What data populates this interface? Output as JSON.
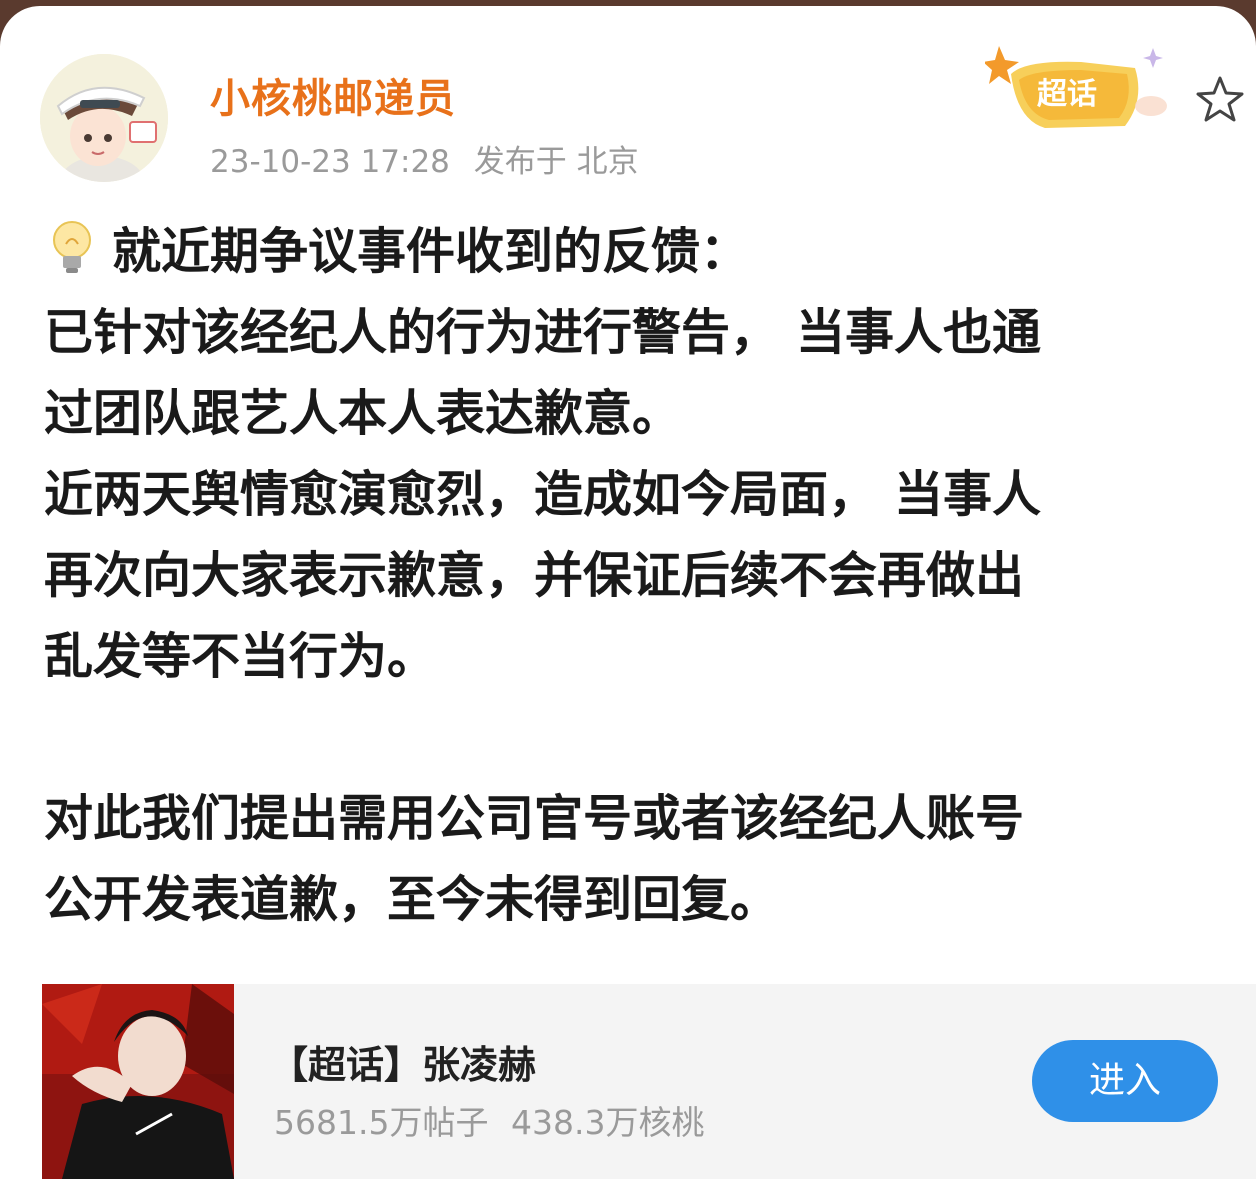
{
  "post": {
    "author": "小核桃邮递员",
    "timestamp": "23-10-23 17:28",
    "location": "发布于 北京",
    "badge_label": "超话",
    "content_lines": [
      "就近期争议事件收到的反馈：",
      "已针对该经纪人的行为进行警告， 当事人也通",
      "过团队跟艺人本人表达歉意。",
      "近两天舆情愈演愈烈，造成如今局面， 当事人",
      "再次向大家表示歉意，并保证后续不会再做出",
      "乱发等不当行为。",
      "",
      "对此我们提出需用公司官号或者该经纪人账号",
      "公开发表道歉，至今未得到回复。"
    ]
  },
  "topic_card": {
    "title": "【超话】张凌赫",
    "posts": "5681.5万帖子",
    "members": "438.3万核桃",
    "enter_label": "进入"
  },
  "icons": {
    "bulb": "lightbulb-icon",
    "star": "star-outline-icon",
    "badge": "super-topic-badge-icon"
  },
  "colors": {
    "author": "#e8711a",
    "enter_button": "#2f90e8",
    "badge": "#f5c84a"
  }
}
